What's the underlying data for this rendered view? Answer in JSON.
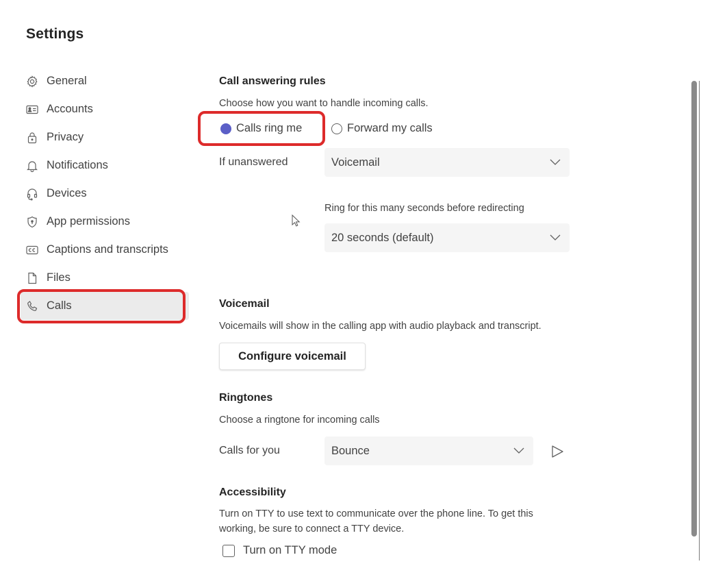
{
  "page": {
    "title": "Settings"
  },
  "sidebar": {
    "items": [
      {
        "label": "General",
        "icon": "gear-icon"
      },
      {
        "label": "Accounts",
        "icon": "id-card-icon"
      },
      {
        "label": "Privacy",
        "icon": "lock-icon"
      },
      {
        "label": "Notifications",
        "icon": "bell-icon"
      },
      {
        "label": "Devices",
        "icon": "headset-icon"
      },
      {
        "label": "App permissions",
        "icon": "shield-icon"
      },
      {
        "label": "Captions and transcripts",
        "icon": "cc-icon"
      },
      {
        "label": "Files",
        "icon": "file-icon"
      },
      {
        "label": "Calls",
        "icon": "phone-icon",
        "active": true
      }
    ]
  },
  "call_answering": {
    "heading": "Call answering rules",
    "description": "Choose how you want to handle incoming calls.",
    "options": [
      {
        "label": "Calls ring me",
        "selected": true
      },
      {
        "label": "Forward my calls",
        "selected": false
      }
    ],
    "if_unanswered_label": "If unanswered",
    "if_unanswered_value": "Voicemail",
    "ring_label": "Ring for this many seconds before redirecting",
    "ring_value": "20 seconds (default)"
  },
  "voicemail": {
    "heading": "Voicemail",
    "description": "Voicemails will show in the calling app with audio playback and transcript.",
    "button_label": "Configure voicemail"
  },
  "ringtones": {
    "heading": "Ringtones",
    "description": "Choose a ringtone for incoming calls",
    "calls_for_you_label": "Calls for you",
    "calls_for_you_value": "Bounce"
  },
  "accessibility": {
    "heading": "Accessibility",
    "description_line1": "Turn on TTY to use text to communicate over the phone line. To get this",
    "description_line2": "working, be sure to connect a TTY device.",
    "tty_label": "Turn on TTY mode",
    "tty_checked": false
  },
  "colors": {
    "accent": "#5b5fc7",
    "annotation_red": "#dd2b2b"
  }
}
